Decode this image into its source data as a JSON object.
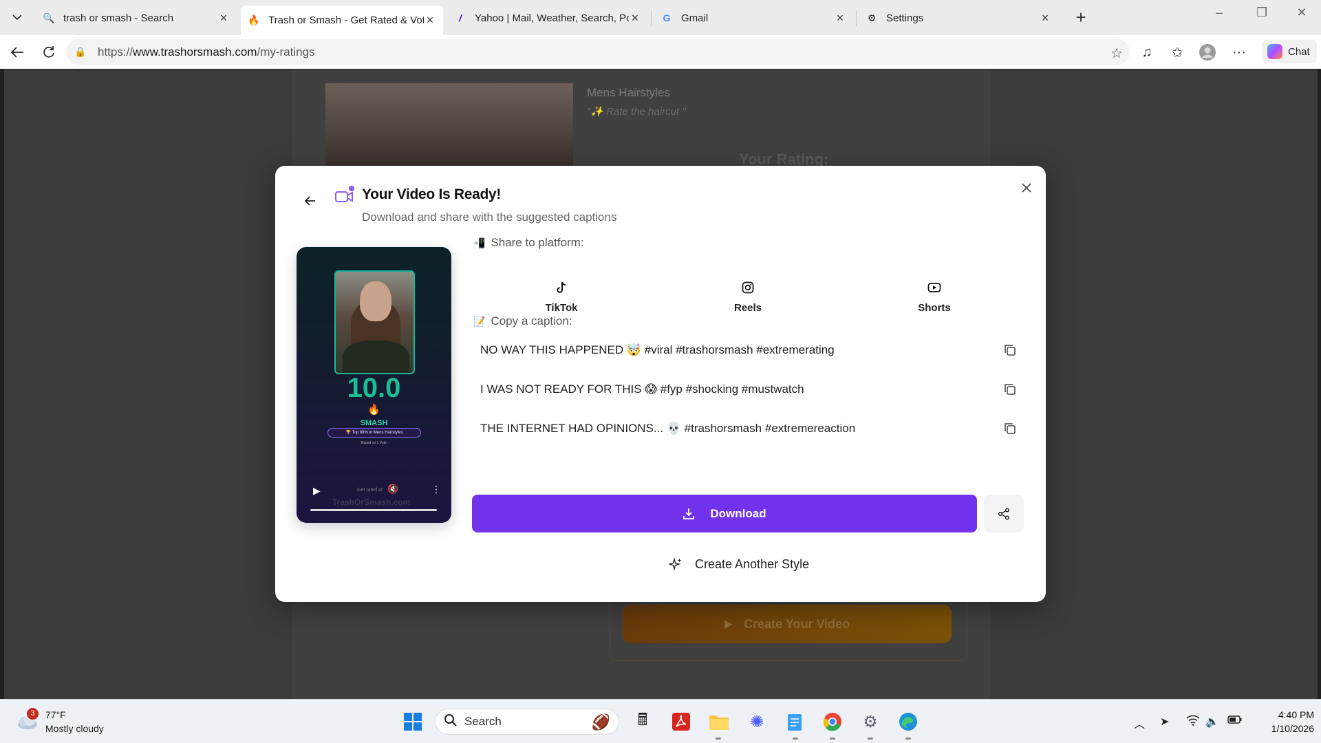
{
  "browser": {
    "tabs": [
      {
        "title": "trash or smash - Search",
        "icon": "search-icon",
        "active": false
      },
      {
        "title": "Trash or Smash - Get Rated & Vote",
        "icon": "flame-icon",
        "active": true
      },
      {
        "title": "Yahoo | Mail, Weather, Search, Politics",
        "icon": "yahoo-icon",
        "active": false
      },
      {
        "title": "Gmail",
        "icon": "google-icon",
        "active": false
      },
      {
        "title": "Settings",
        "icon": "gear-icon",
        "active": false
      }
    ],
    "url_prefix": "https://",
    "url_host": "www.trashorsmash.com",
    "url_path": "/my-ratings",
    "chat_label": "Chat"
  },
  "background_page": {
    "title": "Mens Hairstyles",
    "subtitle": "\"✨ Rate the haircut \"",
    "rating_heading": "Your Rating:",
    "create_video_label": "Create Your Video"
  },
  "modal": {
    "title": "Your Video Is Ready!",
    "subtitle": "Download and share with the suggested captions",
    "preview": {
      "score": "10.0",
      "verdict": "SMASH",
      "badge": "🏆 Top 88% in Mens Hairstyles",
      "based_on": "Based on 1 Vote",
      "footer_text": "Get rated at",
      "watermark": "TrashOrSmash.com"
    },
    "share_label": "Share to platform:",
    "platforms": [
      {
        "name": "TikTok",
        "icon": "tiktok-icon"
      },
      {
        "name": "Reels",
        "icon": "instagram-icon"
      },
      {
        "name": "Shorts",
        "icon": "youtube-icon"
      }
    ],
    "caption_label": "Copy a caption:",
    "captions": [
      "NO WAY THIS HAPPENED 🤯 #viral #trashorsmash #extremerating",
      "I WAS NOT READY FOR THIS 😱 #fyp #shocking #mustwatch",
      "THE INTERNET HAD OPINIONS... 💀 #trashorsmash #extremereaction"
    ],
    "download_label": "Download",
    "another_label": "Create Another Style",
    "accent_color": "#7132ee"
  },
  "taskbar": {
    "weather_temp": "77°F",
    "weather_desc": "Mostly cloudy",
    "weather_badge": "3",
    "search_label": "Search",
    "time": "4:40 PM",
    "date": "1/10/2026"
  }
}
